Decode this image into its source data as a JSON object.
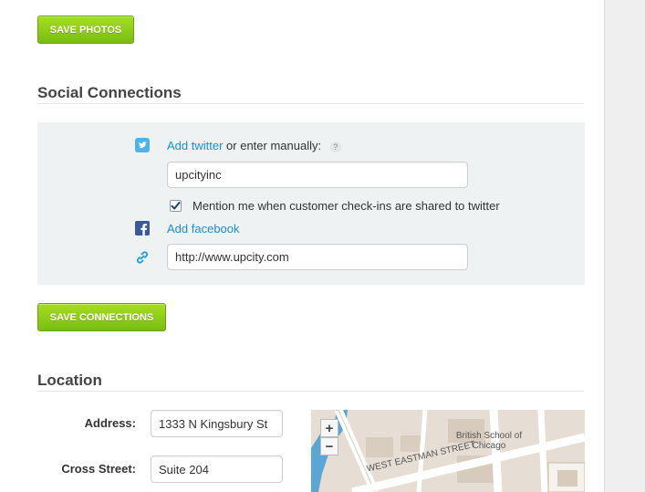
{
  "photos": {
    "save_label": "SAVE PHOTOS"
  },
  "social": {
    "title": "Social Connections",
    "twitter": {
      "add_link": "Add twitter",
      "manual_text": "or enter manually:",
      "help": "?",
      "value": "upcityinc",
      "mention_checked": true,
      "mention_label": "Mention me when customer check-ins are shared to twitter"
    },
    "facebook": {
      "add_link": "Add facebook"
    },
    "website": {
      "value": "http://www.upcity.com"
    },
    "save_label": "SAVE CONNECTIONS"
  },
  "location": {
    "title": "Location",
    "address_label": "Address:",
    "address_value": "1333 N Kingsbury St",
    "cross_street_label": "Cross Street:",
    "cross_street_value": "Suite 204",
    "map": {
      "zoom_in": "+",
      "zoom_out": "−",
      "labels": {
        "school_line1": "British School of",
        "school_line2": "Chicago",
        "street": "WEST EASTMAN STREET"
      }
    }
  },
  "colors": {
    "accent_green": "#8fcf19",
    "link_blue": "#1a8fd1",
    "twitter_blue": "#4fb3e8",
    "facebook_blue": "#3b5998",
    "river_blue": "#5aa7d6"
  },
  "icons": [
    "twitter-icon",
    "facebook-icon",
    "link-icon",
    "checkmark-icon"
  ]
}
